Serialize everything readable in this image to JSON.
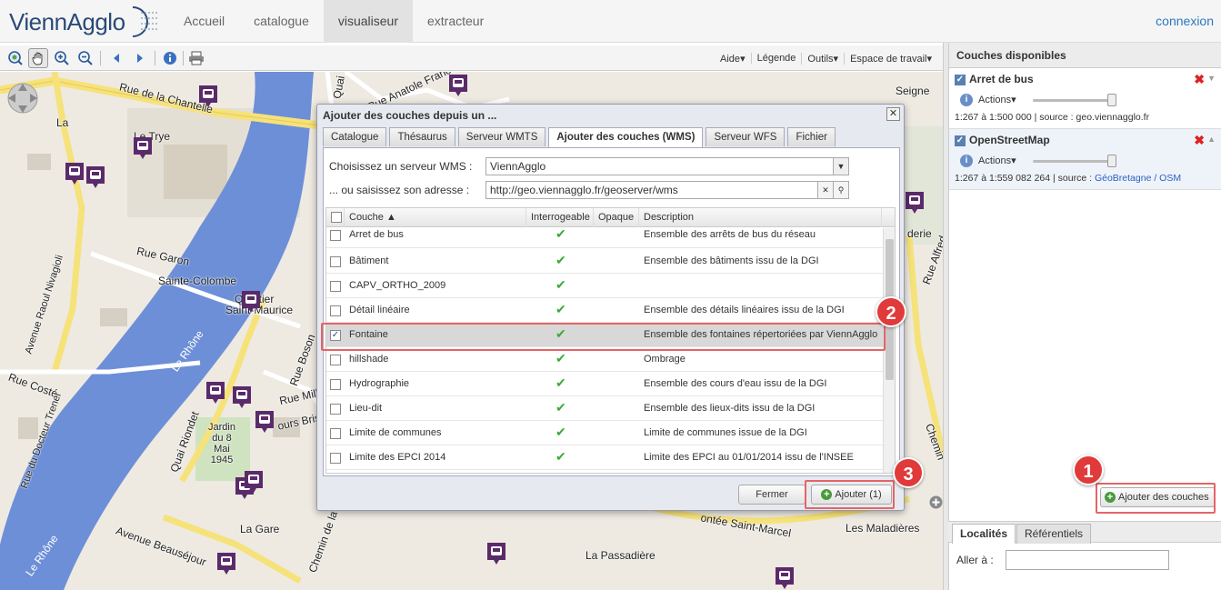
{
  "header": {
    "logo_text": "ViennAgglo",
    "nav": [
      {
        "label": "Accueil"
      },
      {
        "label": "catalogue"
      },
      {
        "label": "visualiseur",
        "active": true
      },
      {
        "label": "extracteur"
      }
    ],
    "login": "connexion"
  },
  "toolbar": {
    "icons": [
      "zoom-extent-icon",
      "pan-hand-icon",
      "zoom-in-icon",
      "zoom-out-icon",
      "back-icon",
      "forward-icon",
      "info-icon",
      "print-icon"
    ],
    "menus": [
      "Aide",
      "Légende",
      "Outils",
      "Espace de travail"
    ]
  },
  "map": {
    "labels": [
      "Rue de la Chantelle",
      "La",
      "Le Trye",
      "Rue Garon",
      "Sainte-Colombe",
      "Quartier",
      "Saint-Maurice",
      "Avenue Raoul Nivagioli",
      "Le Rhône",
      "Rue Costé",
      "Rue du Docteur Trenel",
      "Quai Riondet",
      "Jardin du 8 Mai 1945",
      "Rue Boson",
      "Rue Mille",
      "ours Bris",
      "La Gare",
      "Avenue Beauséjour",
      "Le Rhône",
      "Chemin de la",
      "La Passadière",
      "ontée Saint-Marcel",
      "Les Maladières",
      "Seigne",
      "derie",
      "Rue Alfred",
      "Chemin",
      "Quai",
      "Rue Anatole France"
    ]
  },
  "sidebar": {
    "title": "Couches disponibles",
    "layers": [
      {
        "name": "Arret de bus",
        "actions": "Actions",
        "scale": "1:267 à 1:500 000",
        "source_label": "source :",
        "source": "geo.viennagglo.fr"
      },
      {
        "name": "OpenStreetMap",
        "actions": "Actions",
        "scale": "1:267 à 1:559 082 264",
        "source_label": "source :",
        "source": "GéoBretagne / OSM"
      }
    ],
    "add_button": "Ajouter des couches",
    "bottom_tabs": [
      "Localités",
      "Référentiels"
    ],
    "goto_label": "Aller à :",
    "goto_value": ""
  },
  "dialog": {
    "title": "Ajouter des couches depuis un ...",
    "tabs": [
      {
        "label": "Catalogue"
      },
      {
        "label": "Thésaurus"
      },
      {
        "label": "Serveur WMTS"
      },
      {
        "label": "Ajouter des couches (WMS)",
        "active": true
      },
      {
        "label": "Serveur WFS"
      },
      {
        "label": "Fichier"
      }
    ],
    "server_label": "Choisissez un serveur WMS :",
    "server_value": "ViennAgglo",
    "address_label": "... ou saisissez son adresse :",
    "address_value": "http://geo.viennagglo.fr/geoserver/wms",
    "columns": [
      "Couche ▲",
      "Interrogeable",
      "Opaque",
      "Description"
    ],
    "rows": [
      {
        "name": "Arret de bus",
        "queryable": true,
        "checked": false,
        "description": "Ensemble des arrêts de bus du réseau"
      },
      {
        "name": "Bâtiment",
        "queryable": true,
        "checked": false,
        "description": "Ensemble des bâtiments issu de la DGI"
      },
      {
        "name": "CAPV_ORTHO_2009",
        "queryable": true,
        "checked": false,
        "description": ""
      },
      {
        "name": "Détail linéaire",
        "queryable": true,
        "checked": false,
        "description": "Ensemble des détails linéaires issu de la DGI"
      },
      {
        "name": "Fontaine",
        "queryable": true,
        "checked": true,
        "description": "Ensemble des fontaines répertoriées par ViennAgglo"
      },
      {
        "name": "hillshade",
        "queryable": true,
        "checked": false,
        "description": "Ombrage"
      },
      {
        "name": "Hydrographie",
        "queryable": true,
        "checked": false,
        "description": "Ensemble des cours d'eau issu de la DGI"
      },
      {
        "name": "Lieu-dit",
        "queryable": true,
        "checked": false,
        "description": "Ensemble des lieux-dits issu de la DGI"
      },
      {
        "name": "Limite de communes",
        "queryable": true,
        "checked": false,
        "description": "Limite de communes issue de la DGI"
      },
      {
        "name": "Limite des EPCI 2014",
        "queryable": true,
        "checked": false,
        "description": "Limite des EPCI au 01/01/2014 issu de l'INSEE"
      }
    ],
    "close_button": "Fermer",
    "add_button": "Ajouter (1)"
  },
  "callouts": [
    "1",
    "2",
    "3"
  ],
  "colors": {
    "accent": "#2a78c0",
    "highlight": "#e56565",
    "river": "#6d8fd8",
    "road": "#f6e27a",
    "poi": "#5a2a6a"
  }
}
